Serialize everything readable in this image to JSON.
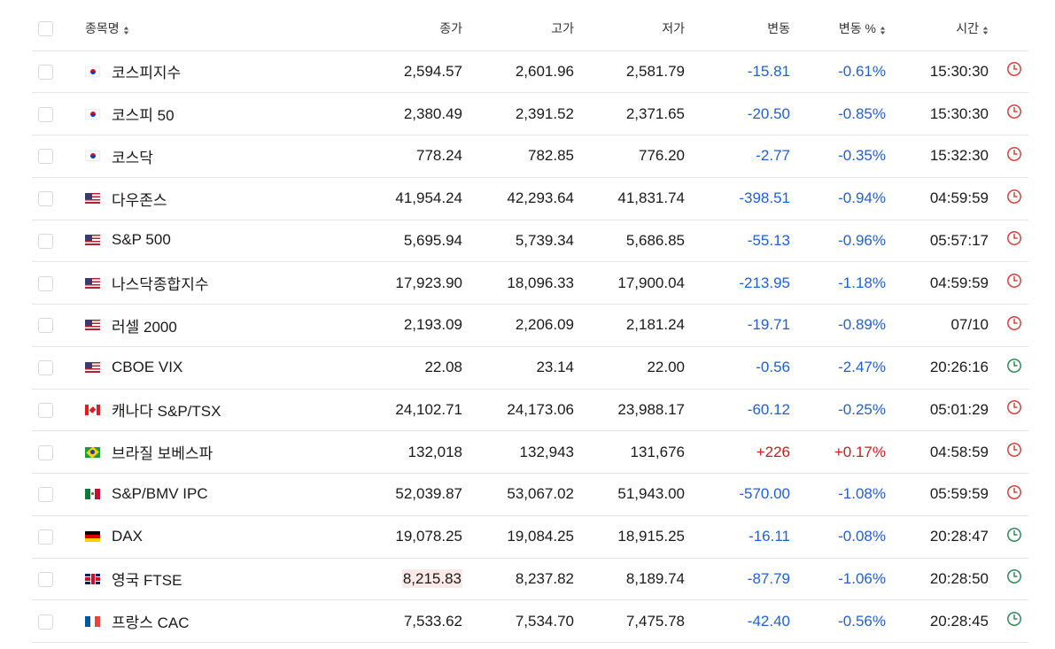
{
  "header": {
    "name": "종목명",
    "close": "종가",
    "high": "고가",
    "low": "저가",
    "change": "변동",
    "change_pct": "변동 %",
    "time": "시간",
    "sort_icon": "sort-updown-icon"
  },
  "colors": {
    "negative": "#1f5fdc",
    "positive": "#d11a1a",
    "market_closed_clock": "#d9413a",
    "market_open_clock": "#2e8b57"
  },
  "rows": [
    {
      "flag": "kr",
      "name": "코스피지수",
      "close": "2,594.57",
      "high": "2,601.96",
      "low": "2,581.79",
      "change": "-15.81",
      "change_pct": "-0.61%",
      "time": "15:30:30",
      "direction": "neg",
      "clock": "closed"
    },
    {
      "flag": "kr",
      "name": "코스피 50",
      "close": "2,380.49",
      "high": "2,391.52",
      "low": "2,371.65",
      "change": "-20.50",
      "change_pct": "-0.85%",
      "time": "15:30:30",
      "direction": "neg",
      "clock": "closed"
    },
    {
      "flag": "kr",
      "name": "코스닥",
      "close": "778.24",
      "high": "782.85",
      "low": "776.20",
      "change": "-2.77",
      "change_pct": "-0.35%",
      "time": "15:32:30",
      "direction": "neg",
      "clock": "closed"
    },
    {
      "flag": "us",
      "name": "다우존스",
      "close": "41,954.24",
      "high": "42,293.64",
      "low": "41,831.74",
      "change": "-398.51",
      "change_pct": "-0.94%",
      "time": "04:59:59",
      "direction": "neg",
      "clock": "closed"
    },
    {
      "flag": "us",
      "name": "S&P 500",
      "close": "5,695.94",
      "high": "5,739.34",
      "low": "5,686.85",
      "change": "-55.13",
      "change_pct": "-0.96%",
      "time": "05:57:17",
      "direction": "neg",
      "clock": "closed"
    },
    {
      "flag": "us",
      "name": "나스닥종합지수",
      "close": "17,923.90",
      "high": "18,096.33",
      "low": "17,900.04",
      "change": "-213.95",
      "change_pct": "-1.18%",
      "time": "04:59:59",
      "direction": "neg",
      "clock": "closed"
    },
    {
      "flag": "us",
      "name": "러셀 2000",
      "close": "2,193.09",
      "high": "2,206.09",
      "low": "2,181.24",
      "change": "-19.71",
      "change_pct": "-0.89%",
      "time": "07/10",
      "direction": "neg",
      "clock": "closed"
    },
    {
      "flag": "us",
      "name": "CBOE VIX",
      "close": "22.08",
      "high": "23.14",
      "low": "22.00",
      "change": "-0.56",
      "change_pct": "-2.47%",
      "time": "20:26:16",
      "direction": "neg",
      "clock": "open"
    },
    {
      "flag": "ca",
      "name": "캐나다 S&P/TSX",
      "close": "24,102.71",
      "high": "24,173.06",
      "low": "23,988.17",
      "change": "-60.12",
      "change_pct": "-0.25%",
      "time": "05:01:29",
      "direction": "neg",
      "clock": "closed"
    },
    {
      "flag": "br",
      "name": "브라질 보베스파",
      "close": "132,018",
      "high": "132,943",
      "low": "131,676",
      "change": "+226",
      "change_pct": "+0.17%",
      "time": "04:58:59",
      "direction": "pos",
      "clock": "closed"
    },
    {
      "flag": "mx",
      "name": "S&P/BMV IPC",
      "close": "52,039.87",
      "high": "53,067.02",
      "low": "51,943.00",
      "change": "-570.00",
      "change_pct": "-1.08%",
      "time": "05:59:59",
      "direction": "neg",
      "clock": "closed"
    },
    {
      "flag": "de",
      "name": "DAX",
      "close": "19,078.25",
      "high": "19,084.25",
      "low": "18,915.25",
      "change": "-16.11",
      "change_pct": "-0.08%",
      "time": "20:28:47",
      "direction": "neg",
      "clock": "open"
    },
    {
      "flag": "gb",
      "name": "영국 FTSE",
      "close": "8,215.83",
      "high": "8,237.82",
      "low": "8,189.74",
      "change": "-87.79",
      "change_pct": "-1.06%",
      "time": "20:28:50",
      "direction": "neg",
      "clock": "open",
      "close_highlight": true
    },
    {
      "flag": "fr",
      "name": "프랑스 CAC",
      "close": "7,533.62",
      "high": "7,534.70",
      "low": "7,475.78",
      "change": "-42.40",
      "change_pct": "-0.56%",
      "time": "20:28:45",
      "direction": "neg",
      "clock": "open"
    }
  ]
}
